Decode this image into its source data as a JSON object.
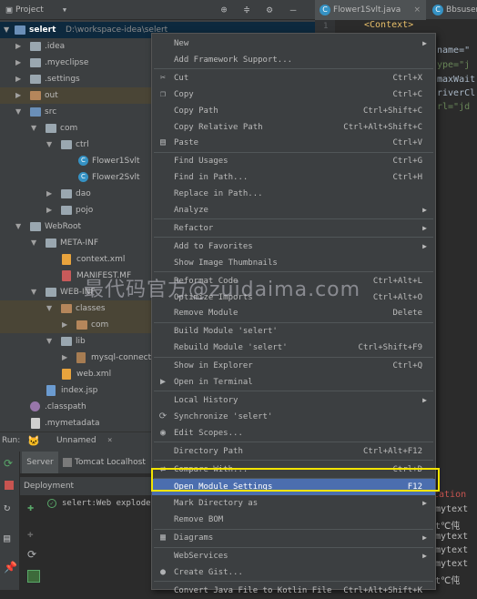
{
  "project_panel": {
    "title": "Project",
    "tree": [
      {
        "label": "selert",
        "extra": "D:\\workspace-idea\\selert",
        "bold": true
      },
      {
        "label": ".idea"
      },
      {
        "label": ".myeclipse"
      },
      {
        "label": ".settings"
      },
      {
        "label": "out"
      },
      {
        "label": "src"
      },
      {
        "label": "com"
      },
      {
        "label": "ctrl"
      },
      {
        "label": "Flower1Svlt"
      },
      {
        "label": "Flower2Svlt"
      },
      {
        "label": "dao"
      },
      {
        "label": "pojo"
      },
      {
        "label": "WebRoot"
      },
      {
        "label": "META-INF"
      },
      {
        "label": "context.xml"
      },
      {
        "label": "MANIFEST.MF"
      },
      {
        "label": "WEB-INF"
      },
      {
        "label": "classes"
      },
      {
        "label": "com"
      },
      {
        "label": "lib"
      },
      {
        "label": "mysql-connect"
      },
      {
        "label": "web.xml"
      },
      {
        "label": "index.jsp"
      },
      {
        "label": ".classpath"
      },
      {
        "label": ".mymetadata"
      }
    ]
  },
  "editor": {
    "tabs": [
      "Flower1Svlt.java",
      "Bbsuser"
    ],
    "line_number": "1",
    "lines": [
      "<Context>",
      "name=\"",
      "ype=\"j",
      "maxWait",
      "riverCl",
      "rl=\"jd"
    ]
  },
  "run_panel": {
    "run_label": "Run:",
    "config_name": "Unnamed",
    "tabs": [
      "Server",
      "Tomcat Localhost"
    ],
    "deployment_header": "Deployment",
    "deployment_item": "selert:Web exploded",
    "console_lines": [
      "cation",
      "mytext",
      "t℃伅",
      "mytext",
      "mytext",
      "mytext",
      "t℃伅"
    ]
  },
  "context_menu": {
    "items": [
      {
        "label": "New",
        "submenu": true
      },
      {
        "label": "Add Framework Support..."
      },
      {
        "sep": true
      },
      {
        "label": "Cut",
        "shortcut": "Ctrl+X",
        "icon": "cut-icon",
        "glyph": "✂"
      },
      {
        "label": "Copy",
        "shortcut": "Ctrl+C",
        "icon": "copy-icon",
        "glyph": "❐"
      },
      {
        "label": "Copy Path",
        "shortcut": "Ctrl+Shift+C"
      },
      {
        "label": "Copy Relative Path",
        "shortcut": "Ctrl+Alt+Shift+C"
      },
      {
        "label": "Paste",
        "shortcut": "Ctrl+V",
        "icon": "paste-icon",
        "glyph": "▤"
      },
      {
        "sep": true
      },
      {
        "label": "Find Usages",
        "shortcut": "Ctrl+G"
      },
      {
        "label": "Find in Path...",
        "shortcut": "Ctrl+H"
      },
      {
        "label": "Replace in Path..."
      },
      {
        "label": "Analyze",
        "submenu": true
      },
      {
        "sep": true
      },
      {
        "label": "Refactor",
        "submenu": true
      },
      {
        "sep": true
      },
      {
        "label": "Add to Favorites",
        "submenu": true
      },
      {
        "label": "Show Image Thumbnails"
      },
      {
        "sep": true
      },
      {
        "label": "Reformat Code",
        "shortcut": "Ctrl+Alt+L"
      },
      {
        "label": "Optimize Imports",
        "shortcut": "Ctrl+Alt+O"
      },
      {
        "label": "Remove Module",
        "shortcut": "Delete"
      },
      {
        "sep": true
      },
      {
        "label": "Build Module 'selert'"
      },
      {
        "label": "Rebuild Module 'selert'",
        "shortcut": "Ctrl+Shift+F9"
      },
      {
        "sep": true
      },
      {
        "label": "Show in Explorer",
        "shortcut": "Ctrl+Q"
      },
      {
        "label": "Open in Terminal",
        "icon": "terminal-icon",
        "glyph": "▶"
      },
      {
        "sep": true
      },
      {
        "label": "Local History",
        "submenu": true
      },
      {
        "label": "Synchronize 'selert'",
        "icon": "sync-icon",
        "glyph": "⟳"
      },
      {
        "label": "Edit Scopes...",
        "icon": "scopes-icon",
        "glyph": "◉"
      },
      {
        "sep": true
      },
      {
        "label": "Directory Path",
        "shortcut": "Ctrl+Alt+F12"
      },
      {
        "sep": true
      },
      {
        "label": "Compare With...",
        "shortcut": "Ctrl+D",
        "icon": "compare-icon",
        "glyph": "⇄"
      },
      {
        "sep": true
      },
      {
        "label": "Open Module Settings",
        "shortcut": "F12",
        "highlight": true
      },
      {
        "label": "Mark Directory as",
        "submenu": true
      },
      {
        "label": "Remove BOM"
      },
      {
        "sep": true
      },
      {
        "label": "Diagrams",
        "submenu": true,
        "icon": "diagrams-icon",
        "glyph": "▦"
      },
      {
        "sep": true
      },
      {
        "label": "WebServices",
        "submenu": true
      },
      {
        "label": "Create Gist...",
        "icon": "gist-icon",
        "glyph": "●"
      },
      {
        "sep": true
      },
      {
        "label": "Convert Java File to Kotlin File",
        "shortcut": "Ctrl+Alt+Shift+K"
      }
    ]
  },
  "watermark": "最代码官方@zuidaima.com",
  "colors": {
    "highlight": "#4b6eaf",
    "annotation_box": "#f2e400",
    "background": "#3c3f41"
  }
}
